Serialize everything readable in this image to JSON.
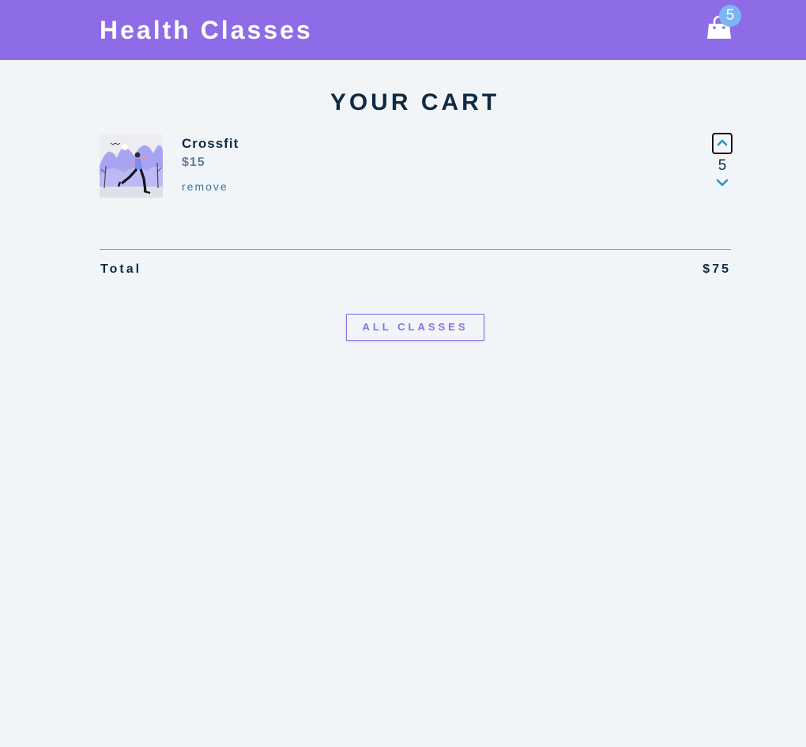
{
  "navbar": {
    "brand": "Health Classes",
    "cart_count": "5",
    "cart_icon": "shopping-bag-icon"
  },
  "cart": {
    "title": "YOUR CART",
    "items": [
      {
        "name": "Crossfit",
        "price": "$15",
        "remove_label": "remove",
        "amount": "5",
        "image": "runner-illustration"
      }
    ],
    "total_label": "Total",
    "total_value": "$75"
  },
  "actions": {
    "all_classes_label": "ALL CLASSES"
  },
  "colors": {
    "navbar": "#8e6ce8",
    "background": "#f1f5f8",
    "badge": "#7cb5f2",
    "accent_blue": "#3c76a5",
    "text": "#102a42"
  }
}
